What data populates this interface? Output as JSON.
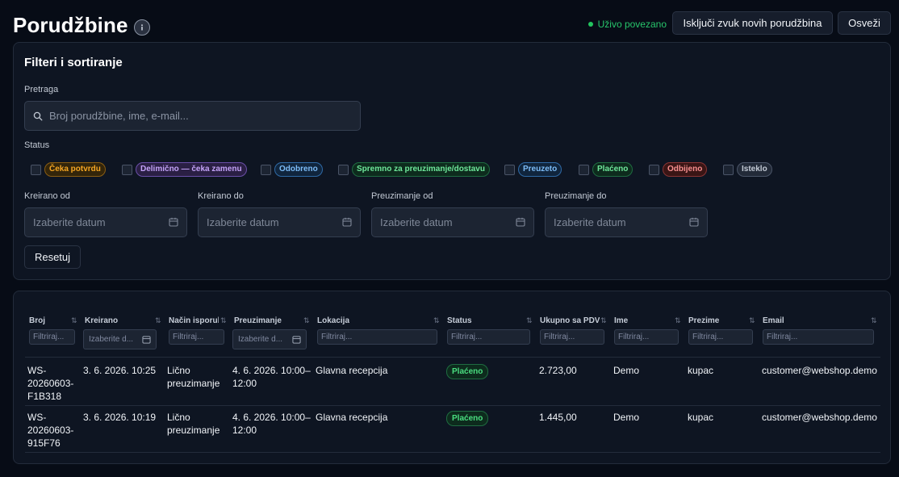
{
  "header": {
    "title": "Porudžbine",
    "live_label": "Uživo povezano",
    "mute_button": "Isključi zvuk novih porudžbina",
    "refresh_button": "Osveži"
  },
  "colors": {
    "background": "#070c16",
    "panel": "#0e1522",
    "live_green": "#22c55e",
    "paid_green": "#4ade80"
  },
  "filters": {
    "title": "Filteri i sortiranje",
    "search_label": "Pretraga",
    "search_placeholder": "Broj porudžbine, ime, e-mail...",
    "status_label": "Status",
    "statuses": [
      {
        "label": "Čeka potvrdu",
        "color": "#f5a623"
      },
      {
        "label": "Delimično — čeka zamenu",
        "color": "#b58cf5"
      },
      {
        "label": "Odobreno",
        "color": "#5aa9f5"
      },
      {
        "label": "Spremno za preuzimanje/dostavu",
        "color": "#4ade80"
      },
      {
        "label": "Preuzeto",
        "color": "#5aa9f5"
      },
      {
        "label": "Plaćeno",
        "color": "#4ade80"
      },
      {
        "label": "Odbijeno",
        "color": "#f87171"
      },
      {
        "label": "Isteklo",
        "color": "#9aa3b2"
      }
    ],
    "dates": [
      {
        "label": "Kreirano od",
        "placeholder": "Izaberite datum"
      },
      {
        "label": "Kreirano do",
        "placeholder": "Izaberite datum"
      },
      {
        "label": "Preuzimanje od",
        "placeholder": "Izaberite datum"
      },
      {
        "label": "Preuzimanje do",
        "placeholder": "Izaberite datum"
      }
    ],
    "reset_button": "Resetuj"
  },
  "table": {
    "columns": [
      {
        "label": "Broj",
        "filter_placeholder": "Filtriraj..."
      },
      {
        "label": "Kreirano",
        "filter_placeholder": "Izaberite d..."
      },
      {
        "label": "Način isporuke",
        "filter_placeholder": "Filtriraj..."
      },
      {
        "label": "Preuzimanje",
        "filter_placeholder": "Izaberite d..."
      },
      {
        "label": "Lokacija",
        "filter_placeholder": "Filtriraj..."
      },
      {
        "label": "Status",
        "filter_placeholder": "Filtriraj..."
      },
      {
        "label": "Ukupno sa PDV",
        "filter_placeholder": "Filtriraj..."
      },
      {
        "label": "Ime",
        "filter_placeholder": "Filtriraj..."
      },
      {
        "label": "Prezime",
        "filter_placeholder": "Filtriraj..."
      },
      {
        "label": "Email",
        "filter_placeholder": "Filtriraj..."
      }
    ],
    "rows": [
      {
        "broj_1": "WS-",
        "broj_2": "20260603-",
        "broj_3": "F1B318",
        "kreirano": "3. 6. 2026. 10:25",
        "nacin_1": "Lično",
        "nacin_2": "preuzimanje",
        "preuzimanje_1": "4. 6. 2026. 10:00–",
        "preuzimanje_2": "12:00",
        "lokacija": "Glavna recepcija",
        "status": "Plaćeno",
        "ukupno": "2.723,00",
        "ime": "Demo",
        "prezime": "kupac",
        "email": "customer@webshop.demo"
      },
      {
        "broj_1": "WS-",
        "broj_2": "20260603-",
        "broj_3": "915F76",
        "kreirano": "3. 6. 2026. 10:19",
        "nacin_1": "Lično",
        "nacin_2": "preuzimanje",
        "preuzimanje_1": "4. 6. 2026. 10:00–",
        "preuzimanje_2": "12:00",
        "lokacija": "Glavna recepcija",
        "status": "Plaćeno",
        "ukupno": "1.445,00",
        "ime": "Demo",
        "prezime": "kupac",
        "email": "customer@webshop.demo"
      }
    ]
  }
}
